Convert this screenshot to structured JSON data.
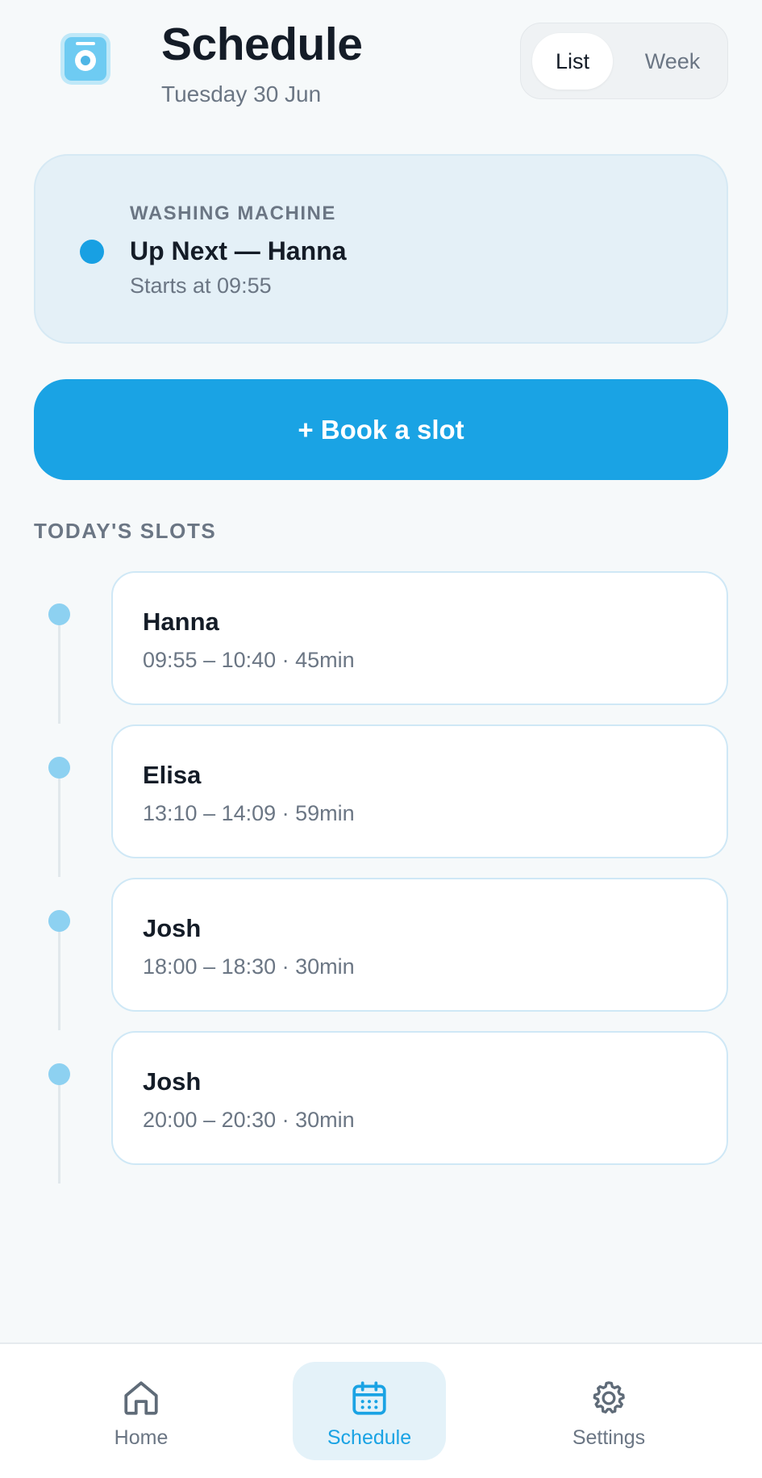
{
  "header": {
    "title": "Schedule",
    "date": "Tuesday 30 Jun",
    "view_toggle": {
      "list_label": "List",
      "week_label": "Week",
      "selected": "List"
    }
  },
  "up_next": {
    "label": "WASHING MACHINE",
    "title": "Up Next — Hanna",
    "time": "Starts at 09:55"
  },
  "book_button": {
    "label": "+ Book a slot"
  },
  "slots_section": {
    "heading": "TODAY'S SLOTS",
    "items": [
      {
        "name": "Hanna",
        "time": "09:55 – 10:40 · 45min"
      },
      {
        "name": "Elisa",
        "time": "13:10 – 14:09 · 59min"
      },
      {
        "name": "Josh",
        "time": "18:00 – 18:30 · 30min"
      },
      {
        "name": "Josh",
        "time": "20:00 – 20:30 · 30min"
      }
    ]
  },
  "bottom_nav": {
    "items": [
      {
        "label": "Home",
        "icon": "home-icon"
      },
      {
        "label": "Schedule",
        "icon": "calendar-icon"
      },
      {
        "label": "Settings",
        "icon": "gear-icon"
      }
    ],
    "active": "Schedule"
  },
  "colors": {
    "accent": "#1aa3e4",
    "timeline_dot": "#8dd1f1",
    "background": "#f6f9fa"
  }
}
